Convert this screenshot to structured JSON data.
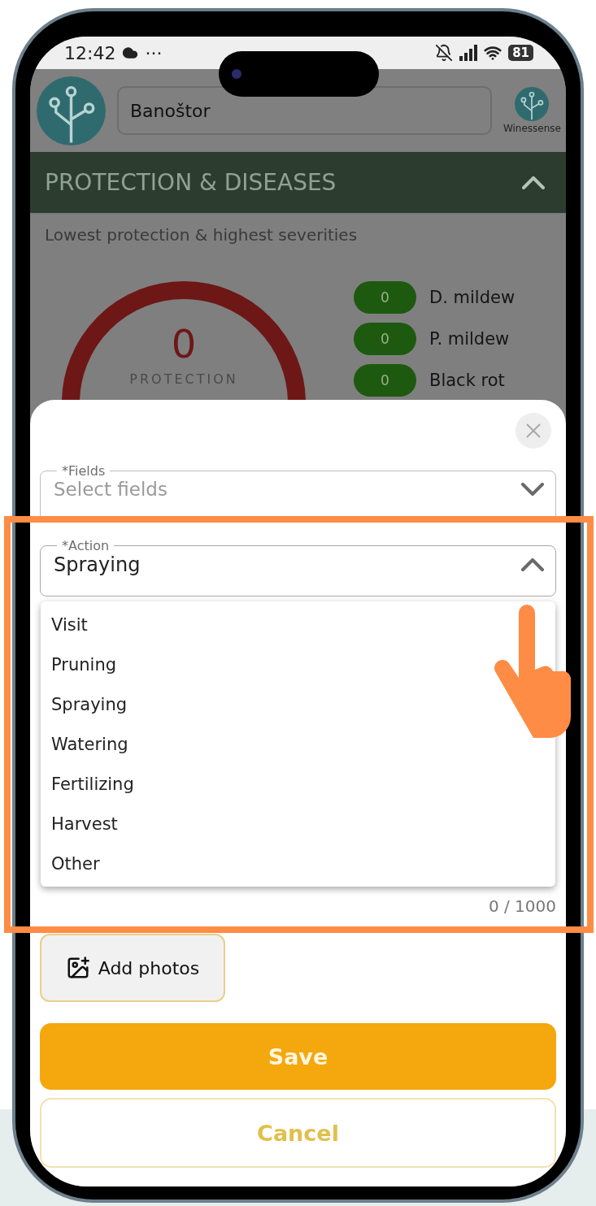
{
  "status_bar": {
    "time": "12:42",
    "dots": "···",
    "battery": "81"
  },
  "header": {
    "location": "Banoštor",
    "brand": "Winessense"
  },
  "section": {
    "title": "PROTECTION & DISEASES",
    "expanded": true,
    "subtitle": "Lowest protection & highest severities"
  },
  "gauge": {
    "value": "0",
    "label": "PROTECTION"
  },
  "diseases": [
    {
      "count": "0",
      "name": "D. mildew"
    },
    {
      "count": "0",
      "name": "P. mildew"
    },
    {
      "count": "0",
      "name": "Black rot"
    }
  ],
  "form": {
    "fields": {
      "label": "*Fields",
      "placeholder": "Select fields",
      "expanded": false
    },
    "action": {
      "label": "*Action",
      "value": "Spraying",
      "expanded": true
    },
    "options": [
      {
        "label": "Visit",
        "selected": false
      },
      {
        "label": "Pruning",
        "selected": false
      },
      {
        "label": "Spraying",
        "selected": false
      },
      {
        "label": "Watering",
        "selected": false
      },
      {
        "label": "Fertilizing",
        "selected": false
      },
      {
        "label": "Harvest",
        "selected": false
      },
      {
        "label": "Other",
        "selected": false
      }
    ],
    "counter": "0 / 1000",
    "add_photos": "Add photos",
    "save": "Save",
    "cancel": "Cancel"
  }
}
